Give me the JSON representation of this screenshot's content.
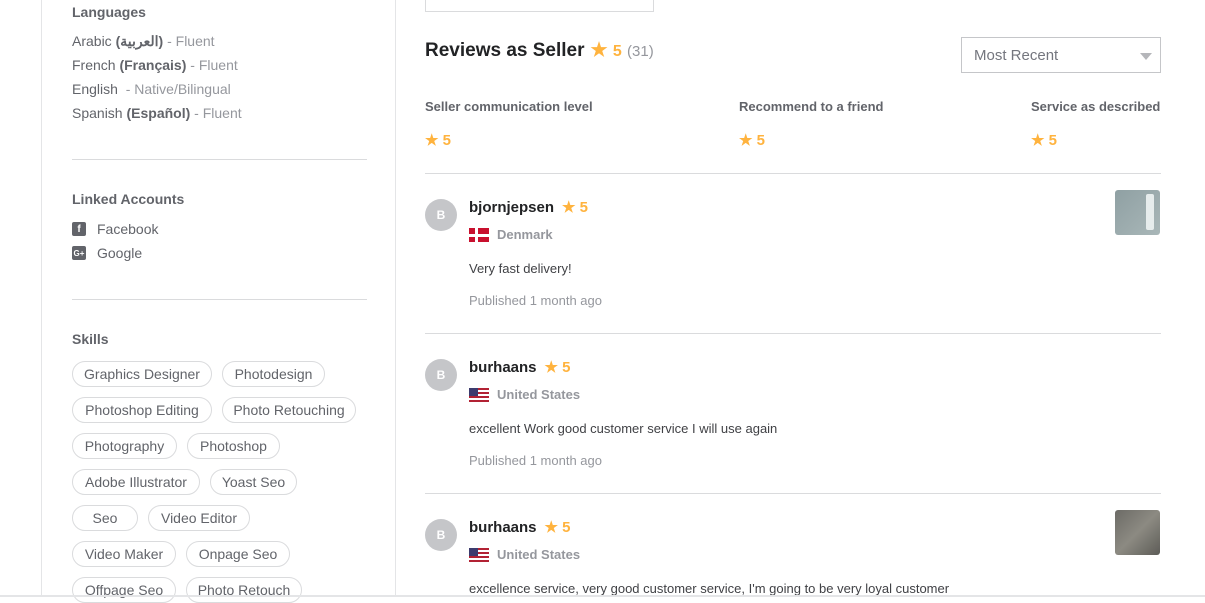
{
  "sidebar": {
    "languages_title": "Languages",
    "languages": [
      {
        "name": "Arabic",
        "native": "(العربية)",
        "sep": " - ",
        "level": "Fluent"
      },
      {
        "name": "French",
        "native": "(Français)",
        "sep": " - ",
        "level": "Fluent"
      },
      {
        "name": "English",
        "native": "",
        "sep": "  - ",
        "level": "Native/Bilingual"
      },
      {
        "name": "Spanish",
        "native": "(Español)",
        "sep": " - ",
        "level": "Fluent"
      }
    ],
    "linked_title": "Linked Accounts",
    "accounts": [
      {
        "label": "Facebook",
        "icon": "facebook-icon",
        "glyph": "f"
      },
      {
        "label": "Google",
        "icon": "google-icon",
        "glyph": "G+"
      }
    ],
    "skills_title": "Skills",
    "skills": [
      "Graphics Designer",
      "Photodesign",
      "Photoshop Editing",
      "Photo Retouching",
      "Photography",
      "Photoshop",
      "Adobe Illustrator",
      "Yoast Seo",
      "Seo",
      "Video Editor",
      "Video Maker",
      "Onpage Seo",
      "Offpage Seo",
      "Photo Retouch"
    ]
  },
  "reviews": {
    "title": "Reviews as Seller",
    "star": "★",
    "average": "5",
    "count": "(31)",
    "sort_value": "Most Recent",
    "breakdown": [
      {
        "label": "Seller communication level",
        "score": "5"
      },
      {
        "label": "Recommend to a friend",
        "score": "5"
      },
      {
        "label": "Service as described",
        "score": "5"
      }
    ],
    "items": [
      {
        "initial": "B",
        "user": "bjornjepsen",
        "rating": "5",
        "country": "Denmark",
        "flag": "dk",
        "comment": "Very fast delivery!",
        "published": "Published 1 month ago",
        "has_thumb": true
      },
      {
        "initial": "B",
        "user": "burhaans",
        "rating": "5",
        "country": "United States",
        "flag": "us",
        "comment": "excellent Work good customer service I will use again",
        "published": "Published 1 month ago",
        "has_thumb": false
      },
      {
        "initial": "B",
        "user": "burhaans",
        "rating": "5",
        "country": "United States",
        "flag": "us",
        "comment": "excellence service, very good customer service, I'm going to be very loyal customer",
        "published": "",
        "has_thumb": true
      }
    ]
  },
  "colors": {
    "star": "#ffb33e",
    "text": "#404145",
    "muted": "#95979d",
    "border": "#dadbdd"
  }
}
